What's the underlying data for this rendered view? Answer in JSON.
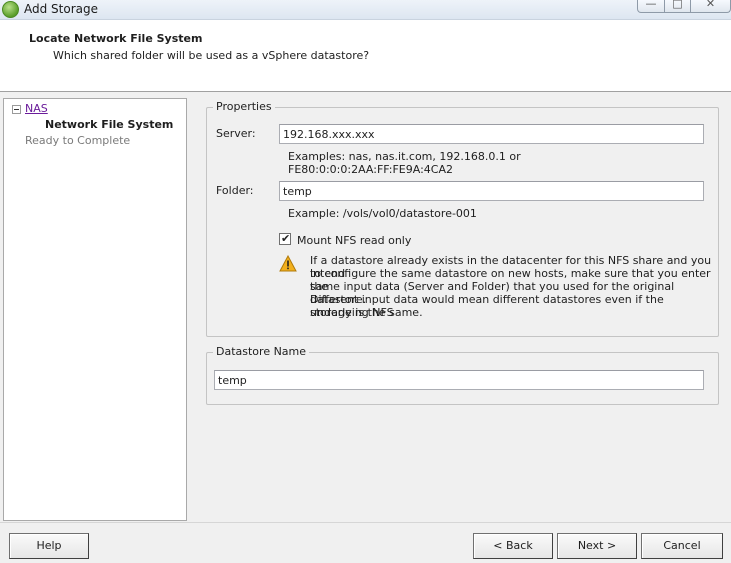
{
  "window": {
    "title": "Add Storage",
    "icon": "vsphere-icon",
    "controls": {
      "minimize": "—",
      "maximize": "□",
      "close": "✕"
    }
  },
  "header": {
    "title": "Locate Network File System",
    "subtitle": "Which shared folder will be used as a vSphere datastore?"
  },
  "nav": {
    "root": "NAS",
    "current": "Network File System",
    "next": "Ready to Complete"
  },
  "properties": {
    "legend": "Properties",
    "server_label": "Server:",
    "server_value": "192.168.xxx.xxx",
    "server_hint_1": "Examples: nas, nas.it.com, 192.168.0.1 or",
    "server_hint_2": "FE80:0:0:0:2AA:FF:FE9A:4CA2",
    "folder_label": "Folder:",
    "folder_value": "temp",
    "folder_hint": "Example: /vols/vol0/datastore-001",
    "readonly_label": "Mount NFS read only",
    "readonly_checked": true,
    "warning_lines": [
      "If a datastore already exists in the datacenter for this NFS share and you intend",
      "to configure the same datastore on new hosts, make sure that you enter the",
      "same input data (Server and Folder) that you used for the original datastore.",
      "Different input data would mean different datastores even if the underlying NFS",
      "storage is the same."
    ]
  },
  "datastore": {
    "legend": "Datastore Name",
    "value": "temp"
  },
  "buttons": {
    "help": "Help",
    "back": "< Back",
    "next": "Next >",
    "cancel": "Cancel"
  },
  "colors": {
    "nav_link": "#6a1b9a",
    "warning": "#f2b01e"
  }
}
